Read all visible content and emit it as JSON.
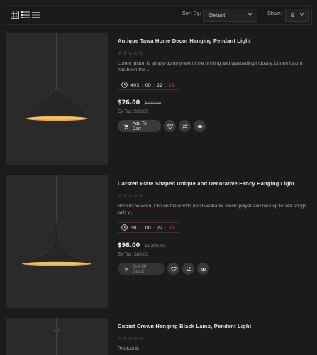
{
  "toolbar": {
    "sort_label": "Sort By:",
    "sort_value": "Default",
    "show_label": "Show:",
    "show_value": "9",
    "views": [
      "grid-view-icon",
      "list-view-icon",
      "compact-list-view-icon"
    ]
  },
  "products": [
    {
      "title": "Antique Tawa Home Decor Hanging Pendant Light",
      "stars": "☆☆☆☆☆",
      "description": "Lorem Ipsum is simply dummy text of the printing and typesetting industry. Lorem Ipsum has been the ..",
      "timer": {
        "days": "403",
        "hours": "00",
        "minutes": "22",
        "seconds": "29"
      },
      "price": "$26.00",
      "old_price": "$122.00",
      "tax": "Ex Tax: $20.00",
      "cart_label": "Add To Cart"
    },
    {
      "title": "Carsten Plate Shaped Unique and Decorative Fancy Hanging Light",
      "stars": "☆☆☆☆☆",
      "description": "Born to be worn. Clip on the worlds most wearable music player and take up to 240 songs with y..",
      "timer": {
        "days": "381",
        "hours": "00",
        "minutes": "22",
        "seconds": "29"
      },
      "price": "$98.00",
      "old_price": "$1,202.00",
      "tax": "Ex Tax: $80.00",
      "cart_label": "Out Of Stock"
    },
    {
      "title": "Cubist Crown Hanging Black Lamp, Pendant Light",
      "stars": "☆☆☆☆☆",
      "description": "Product 8.."
    }
  ],
  "colors": {
    "background": "#1b1b1b",
    "timer_seconds": "#e04040",
    "lamp_inner": "#e8a84a"
  }
}
